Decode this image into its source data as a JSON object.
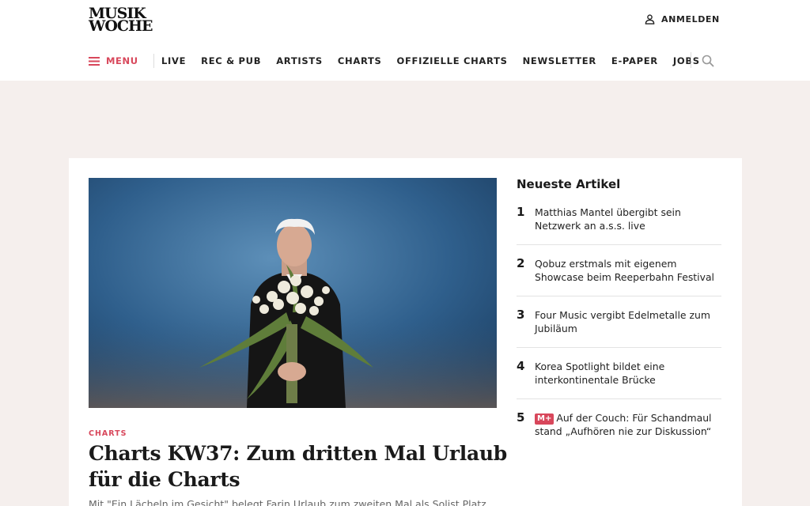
{
  "header": {
    "logo_line1": "MUSIK",
    "logo_line2": "WOCHE",
    "login_label": "ANMELDEN",
    "menu_label": "MENU",
    "nav": [
      {
        "label": "LIVE"
      },
      {
        "label": "REC & PUB"
      },
      {
        "label": "ARTISTS"
      },
      {
        "label": "CHARTS"
      },
      {
        "label": "OFFIZIELLE CHARTS"
      },
      {
        "label": "NEWSLETTER"
      },
      {
        "label": "E-PAPER"
      },
      {
        "label": "JOBS"
      }
    ]
  },
  "main": {
    "kicker": "CHARTS",
    "headline": "Charts KW37: Zum dritten Mal Urlaub für die Charts",
    "teaser": "Mit \"Ein Lächeln im Gesicht\" belegt Farin Urlaub zum zweiten Mal als Solist Platz"
  },
  "latest": {
    "title": "Neueste Artikel",
    "items": [
      {
        "num": "1",
        "text": "Matthias Mantel übergibt sein Netzwerk an a.s.s. live",
        "badge": ""
      },
      {
        "num": "2",
        "text": "Qobuz erstmals mit eigenem Showcase beim Reeperbahn Festival",
        "badge": ""
      },
      {
        "num": "3",
        "text": "Four Music vergibt Edelmetalle zum Jubiläum",
        "badge": ""
      },
      {
        "num": "4",
        "text": "Korea Spotlight bildet eine interkontinentale Brücke",
        "badge": ""
      },
      {
        "num": "5",
        "text": "Auf der Couch: Für Schandmaul stand „Aufhören nie zur Diskussion“",
        "badge": "M+"
      }
    ]
  },
  "colors": {
    "accent": "#d8475b",
    "page_background": "#f5efed"
  },
  "icons": {
    "login": "user-icon",
    "menu": "hamburger-icon",
    "search": "search-icon"
  }
}
